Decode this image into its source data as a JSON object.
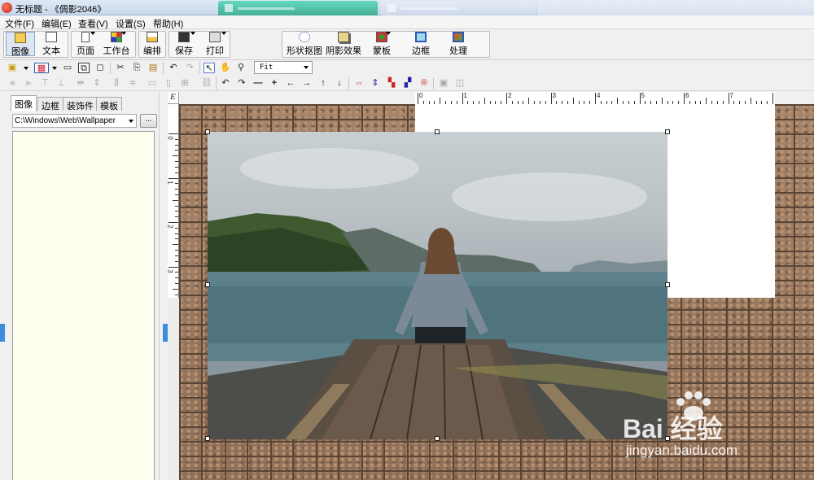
{
  "window": {
    "title": "无标题 - 《倜影2046》"
  },
  "menu": {
    "items": [
      "文件(F)",
      "编辑(E)",
      "查看(V)",
      "设置(S)",
      "帮助(H)"
    ]
  },
  "big_toolbar": {
    "image_label": "图像",
    "text_label": "文本",
    "page_label": "页面",
    "workbench_label": "工作台",
    "layout_label": "编排",
    "save_label": "保存",
    "print_label": "打印",
    "shape_cutout_label": "形状抠图",
    "shadow_label": "阴影效果",
    "mask_label": "蒙板",
    "border_label": "边框",
    "process_label": "处理"
  },
  "zoom": {
    "value": "Fit"
  },
  "left_panel": {
    "tabs": [
      "图像",
      "边框",
      "装饰件",
      "模板"
    ],
    "active_tab": "图像",
    "path": "C:\\Windows\\Web\\Wallpaper",
    "browse_label": "..."
  },
  "ruler": {
    "corner": "E",
    "h_numbers": [
      "0",
      "1",
      "2",
      "3",
      "4",
      "5",
      "6",
      "7"
    ],
    "v_numbers": [
      "0",
      "1",
      "2",
      "3"
    ]
  },
  "watermark": {
    "logo": "Bai  经验",
    "url": "jingyan.baidu.com"
  },
  "colors": {
    "brick": "#8c6d58",
    "mortar": "#5a4535",
    "panel_list_bg": "#fffff0",
    "accent_handle": "#3c8de0"
  }
}
